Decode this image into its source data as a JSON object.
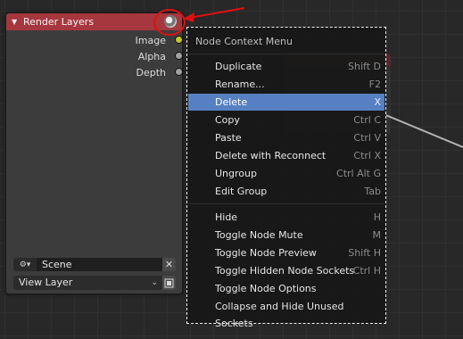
{
  "node": {
    "title": "Render Layers",
    "outputs": [
      "Image",
      "Alpha",
      "Depth"
    ],
    "scene_value": "Scene",
    "view_layer_value": "View Layer",
    "header_color": "#a6373e"
  },
  "menu": {
    "title": "Node Context Menu",
    "items": [
      {
        "label": "Duplicate",
        "shortcut": "Shift D"
      },
      {
        "label": "Rename...",
        "shortcut": "F2"
      },
      {
        "label": "Delete",
        "shortcut": "X"
      },
      {
        "label": "Copy",
        "shortcut": "Ctrl C"
      },
      {
        "label": "Paste",
        "shortcut": "Ctrl V"
      },
      {
        "label": "Delete with Reconnect",
        "shortcut": "Ctrl X"
      },
      {
        "label": "Ungroup",
        "shortcut": "Ctrl Alt G"
      },
      {
        "label": "Edit Group",
        "shortcut": "Tab"
      },
      {
        "label": "Hide",
        "shortcut": "H"
      },
      {
        "label": "Toggle Node Mute",
        "shortcut": "M"
      },
      {
        "label": "Toggle Node Preview",
        "shortcut": "Shift H"
      },
      {
        "label": "Toggle Hidden Node Sockets",
        "shortcut": "Ctrl H"
      },
      {
        "label": "Toggle Node Options",
        "shortcut": ""
      },
      {
        "label": "Collapse and Hide Unused Sockets",
        "shortcut": ""
      }
    ],
    "highlight_color": "#5680c2"
  },
  "icons": {
    "collapse": "triangle-down-icon",
    "scene": "scene-icon",
    "annotation": "red-arrow-annotation"
  }
}
